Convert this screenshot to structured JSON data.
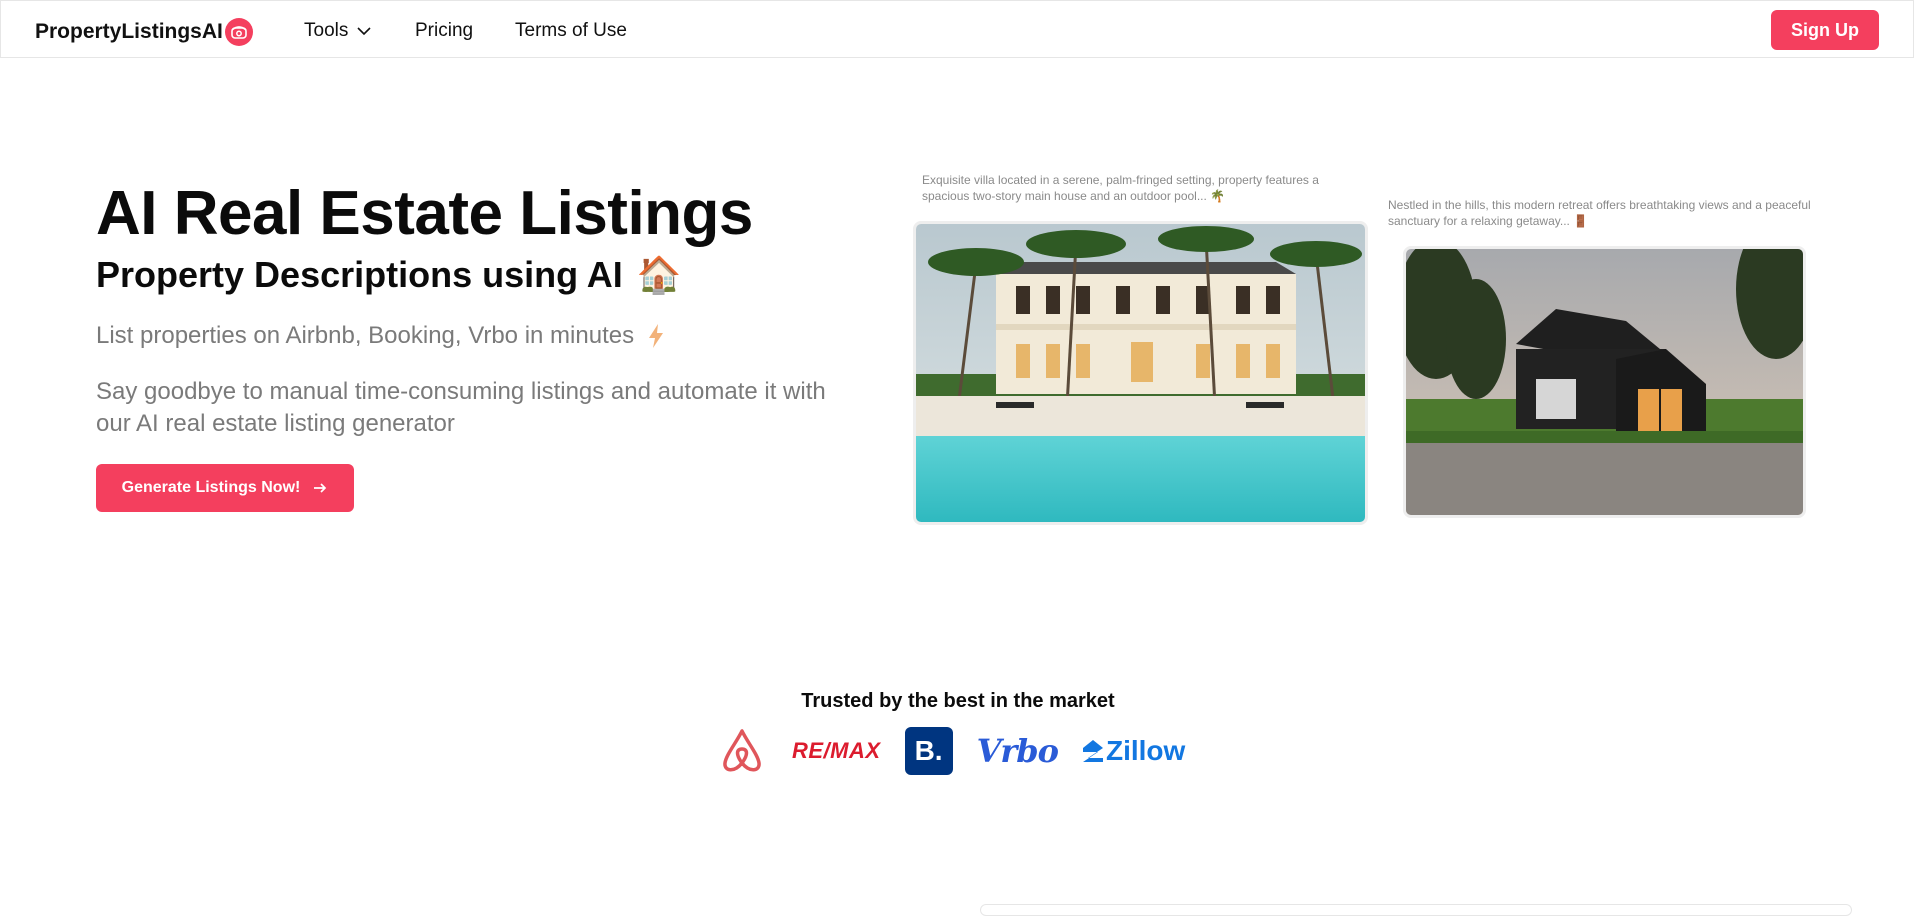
{
  "nav": {
    "brand": "PropertyListingsAI",
    "tools": "Tools",
    "pricing": "Pricing",
    "terms": "Terms of Use",
    "signup": "Sign Up"
  },
  "hero": {
    "title": "AI Real Estate Listings",
    "subtitle": "Property Descriptions using AI",
    "subtitle_emoji": "🏠",
    "line": "List properties on Airbnb, Booking, Vrbo in minutes",
    "line_icon": "lightning-icon",
    "description": "Say goodbye to manual time-consuming listings and automate it with our AI real estate listing generator",
    "cta": "Generate Listings Now!"
  },
  "listings": [
    {
      "caption": "Exquisite villa located in a serene, palm-fringed setting, property features a spacious two-story main house and an outdoor pool... 🌴"
    },
    {
      "caption": "Nestled in the hills, this modern retreat offers breathtaking views and a peaceful sanctuary for a relaxing getaway... 🚪"
    }
  ],
  "trusted": {
    "heading": "Trusted by the best in the market",
    "logos": [
      "airbnb-logo",
      "remax-logo",
      "booking-logo",
      "vrbo-logo",
      "zillow-logo"
    ],
    "remax": "RE/MAX",
    "booking": "B.",
    "vrbo": "Vrbo",
    "zillow": "Zillow"
  },
  "colors": {
    "accent": "#f43f5e",
    "muted_text": "#7a7a7a",
    "airbnb": "#e0565b",
    "remax": "#dc1c2e",
    "booking": "#003580",
    "vrbo": "#2a5bd7",
    "zillow": "#1277e1"
  }
}
